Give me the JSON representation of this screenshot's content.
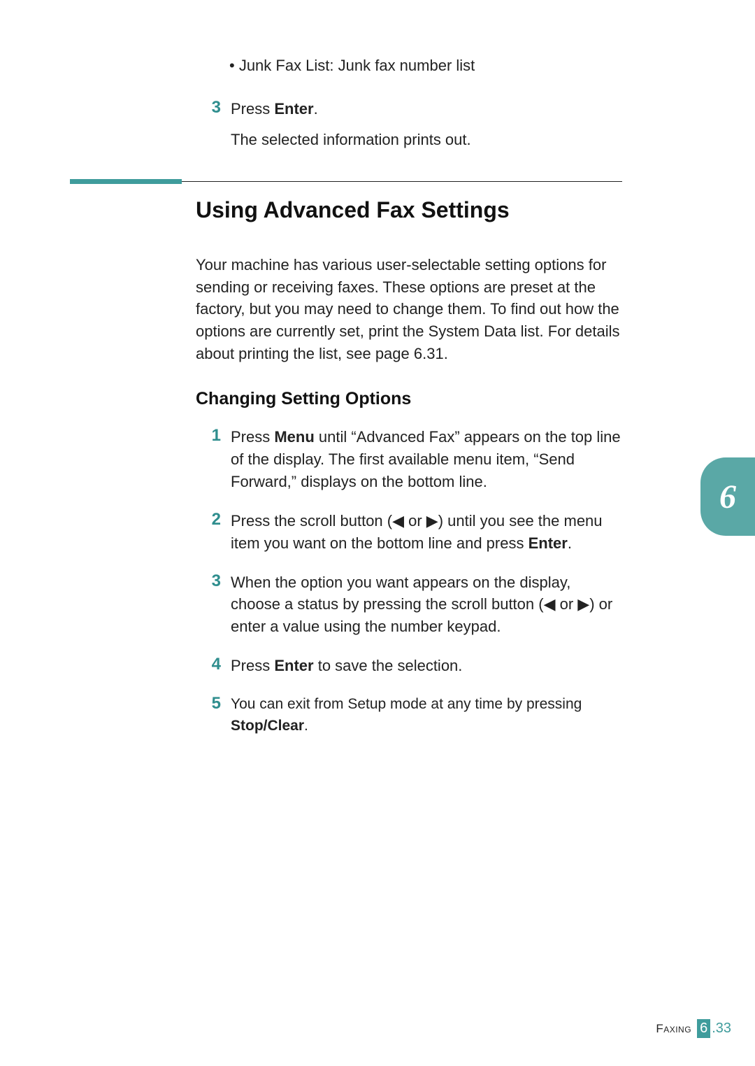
{
  "top": {
    "bullet": "• Junk Fax List: Junk fax number list",
    "step3_num": "3",
    "step3_line1_a": "Press ",
    "step3_line1_b": "Enter",
    "step3_line1_c": ".",
    "step3_line2": "The selected information prints out."
  },
  "section": {
    "title": "Using Advanced Fax Settings",
    "intro": "Your machine has various user-selectable setting options for sending or receiving faxes. These options are preset at the factory, but you may need to change them. To find out how the options are currently set, print the System Data list. For details about printing the list, see page 6.31."
  },
  "subsection": {
    "title": "Changing Setting Options",
    "steps": [
      {
        "num": "1",
        "parts": [
          {
            "t": "Press "
          },
          {
            "t": "Menu",
            "bold": true
          },
          {
            "t": " until “Advanced Fax” appears on the top line of the display. The first available menu item, “Send Forward,” displays on the bottom line."
          }
        ]
      },
      {
        "num": "2",
        "parts": [
          {
            "t": "Press the scroll button (◀ or ▶) until you see the menu item you want on the bottom line and press "
          },
          {
            "t": "Enter",
            "bold": true
          },
          {
            "t": "."
          }
        ]
      },
      {
        "num": "3",
        "parts": [
          {
            "t": "When the option you want appears on the display, choose a status by pressing the scroll button (◀ or ▶) or enter a value using the number keypad."
          }
        ]
      },
      {
        "num": "4",
        "parts": [
          {
            "t": "Press "
          },
          {
            "t": "Enter",
            "bold": true
          },
          {
            "t": " to save the selection."
          }
        ]
      },
      {
        "num": "5",
        "parts": [
          {
            "t": "You can exit from Setup mode at any time by pressing "
          },
          {
            "t": "Stop/Clear",
            "bold": true
          },
          {
            "t": "."
          }
        ]
      }
    ]
  },
  "chapter_tab": "6",
  "footer": {
    "label": "Faxing",
    "chapter": "6",
    "page": ".33"
  }
}
